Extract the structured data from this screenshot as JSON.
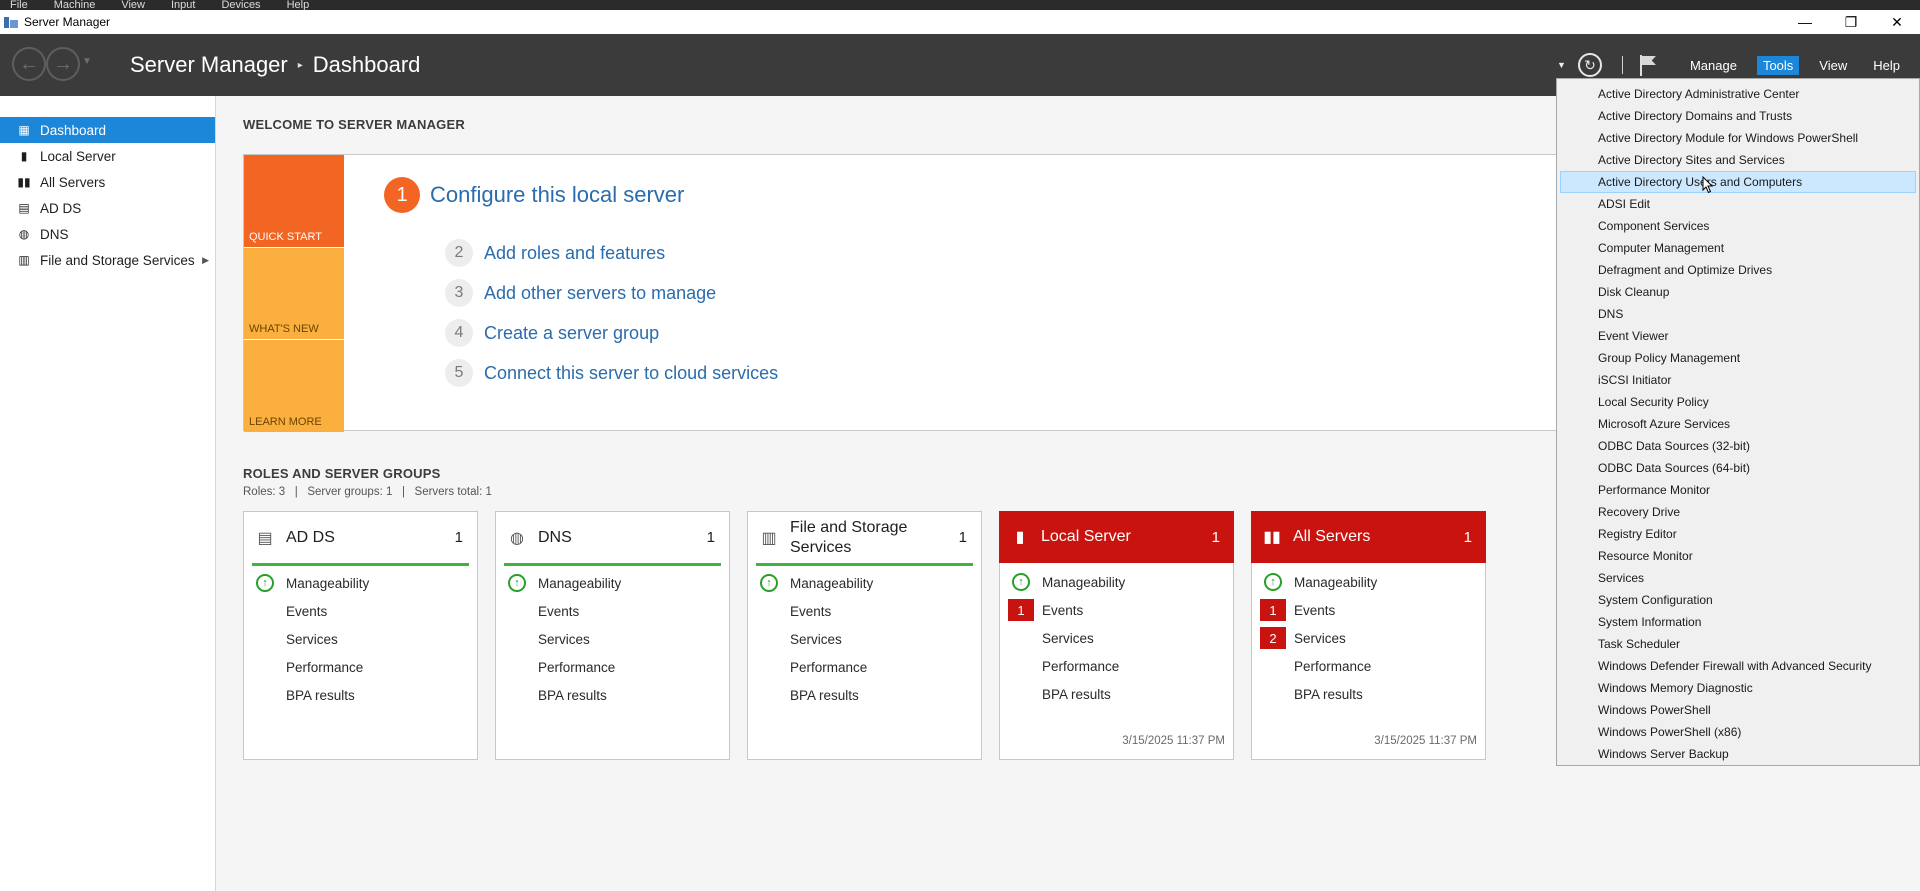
{
  "vm_menu": [
    "File",
    "Machine",
    "View",
    "Input",
    "Devices",
    "Help"
  ],
  "window": {
    "title": "Server Manager",
    "minimize": "—",
    "restore": "❐",
    "close": "✕"
  },
  "header": {
    "breadcrumb_root": "Server Manager",
    "breadcrumb_sep": "▸",
    "breadcrumb_page": "Dashboard",
    "menu": {
      "manage": "Manage",
      "tools": "Tools",
      "view": "View",
      "help": "Help"
    }
  },
  "sidebar": {
    "items": [
      {
        "label": "Dashboard",
        "icon": "dashboard-icon",
        "active": true
      },
      {
        "label": "Local Server",
        "icon": "local-server-icon"
      },
      {
        "label": "All Servers",
        "icon": "all-servers-icon"
      },
      {
        "label": "AD DS",
        "icon": "ad-ds-icon"
      },
      {
        "label": "DNS",
        "icon": "dns-icon"
      },
      {
        "label": "File and Storage Services",
        "icon": "file-storage-icon",
        "has_arrow": true
      }
    ]
  },
  "welcome": {
    "title": "WELCOME TO SERVER MANAGER",
    "tiles": {
      "quick_start": "QUICK START",
      "whats_new": "WHAT'S NEW",
      "learn_more": "LEARN MORE"
    },
    "steps": [
      {
        "num": "1",
        "label": "Configure this local server"
      },
      {
        "num": "2",
        "label": "Add roles and features"
      },
      {
        "num": "3",
        "label": "Add other servers to manage"
      },
      {
        "num": "4",
        "label": "Create a server group"
      },
      {
        "num": "5",
        "label": "Connect this server to cloud services"
      }
    ]
  },
  "roles": {
    "title": "ROLES AND SERVER GROUPS",
    "summary": "Roles: 3   |   Server groups: 1   |   Servers total: 1",
    "cards": [
      {
        "name": "AD DS",
        "count": "1",
        "red": false,
        "rows": [
          "Manageability",
          "Events",
          "Services",
          "Performance",
          "BPA results"
        ],
        "badges": [
          "up",
          "",
          "",
          "",
          ""
        ],
        "time": ""
      },
      {
        "name": "DNS",
        "count": "1",
        "red": false,
        "rows": [
          "Manageability",
          "Events",
          "Services",
          "Performance",
          "BPA results"
        ],
        "badges": [
          "up",
          "",
          "",
          "",
          ""
        ],
        "time": ""
      },
      {
        "name": "File and Storage Services",
        "count": "1",
        "red": false,
        "rows": [
          "Manageability",
          "Events",
          "Services",
          "Performance",
          "BPA results"
        ],
        "badges": [
          "up",
          "",
          "",
          "",
          ""
        ],
        "time": ""
      },
      {
        "name": "Local Server",
        "count": "1",
        "red": true,
        "rows": [
          "Manageability",
          "Events",
          "Services",
          "Performance",
          "BPA results"
        ],
        "badges": [
          "up",
          "1",
          "",
          "",
          ""
        ],
        "time": "3/15/2025 11:37 PM"
      },
      {
        "name": "All Servers",
        "count": "1",
        "red": true,
        "rows": [
          "Manageability",
          "Events",
          "Services",
          "Performance",
          "BPA results"
        ],
        "badges": [
          "up",
          "1",
          "2",
          "",
          ""
        ],
        "time": "3/15/2025 11:37 PM"
      }
    ]
  },
  "tools_menu": {
    "hovered_index": 4,
    "items": [
      "Active Directory Administrative Center",
      "Active Directory Domains and Trusts",
      "Active Directory Module for Windows PowerShell",
      "Active Directory Sites and Services",
      "Active Directory Users and Computers",
      "ADSI Edit",
      "Component Services",
      "Computer Management",
      "Defragment and Optimize Drives",
      "Disk Cleanup",
      "DNS",
      "Event Viewer",
      "Group Policy Management",
      "iSCSI Initiator",
      "Local Security Policy",
      "Microsoft Azure Services",
      "ODBC Data Sources (32-bit)",
      "ODBC Data Sources (64-bit)",
      "Performance Monitor",
      "Recovery Drive",
      "Registry Editor",
      "Resource Monitor",
      "Services",
      "System Configuration",
      "System Information",
      "Task Scheduler",
      "Windows Defender Firewall with Advanced Security",
      "Windows Memory Diagnostic",
      "Windows PowerShell",
      "Windows PowerShell (x86)",
      "Windows Server Backup"
    ]
  },
  "colors": {
    "accent": "#1c86d8",
    "header_bg": "#3b3b3b",
    "quick_start": "#f26522",
    "tile_amber": "#fbaf3f",
    "alert_red": "#c8130f",
    "ok_green": "#3db43d",
    "link_blue": "#2a6cad"
  }
}
